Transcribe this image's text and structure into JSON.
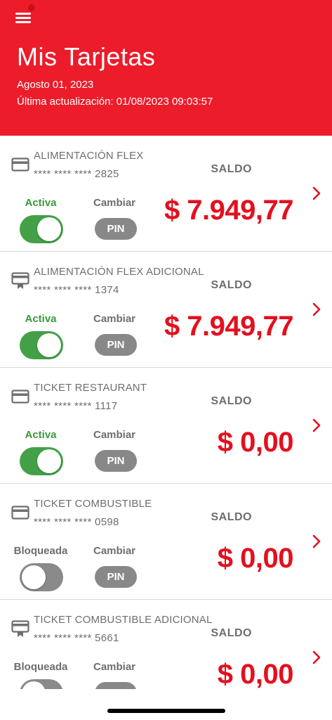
{
  "header": {
    "title": "Mis Tarjetas",
    "date": "Agosto 01, 2023",
    "updated": "Última actualización: 01/08/2023 09:03:57",
    "background": "#ec1c2b"
  },
  "icons": {
    "menu": "hamburger-menu-icon",
    "card": "credit-card-icon",
    "additional_card": "additional-card-icon",
    "chevron": "chevron-right-icon"
  },
  "labels": {
    "saldo": "SALDO",
    "change": "Cambiar",
    "pin": "PIN"
  },
  "cards": [
    {
      "name": "ALIMENTACIÓN FLEX",
      "number": "**** **** **** 2825",
      "status": "Activa",
      "active": true,
      "amount": "$ 7.949,77",
      "additional": false
    },
    {
      "name": "ALIMENTACIÓN FLEX ADICIONAL",
      "number": "**** **** **** 1374",
      "status": "Activa",
      "active": true,
      "amount": "$ 7.949,77",
      "additional": true
    },
    {
      "name": "TICKET RESTAURANT",
      "number": "**** **** **** 1117",
      "status": "Activa",
      "active": true,
      "amount": "$ 0,00",
      "additional": false
    },
    {
      "name": "TICKET COMBUSTIBLE",
      "number": "**** **** **** 0598",
      "status": "Bloqueada",
      "active": false,
      "amount": "$ 0,00",
      "additional": false
    },
    {
      "name": "TICKET COMBUSTIBLE ADICIONAL",
      "number": "**** **** **** 5661",
      "status": "Bloqueada",
      "active": false,
      "amount": "$ 0,00",
      "additional": true
    }
  ],
  "colors": {
    "brand_red": "#ec1c2b",
    "amount_red": "#e3101e",
    "active_green": "#43a047",
    "grey_text": "#6e6e6e"
  }
}
